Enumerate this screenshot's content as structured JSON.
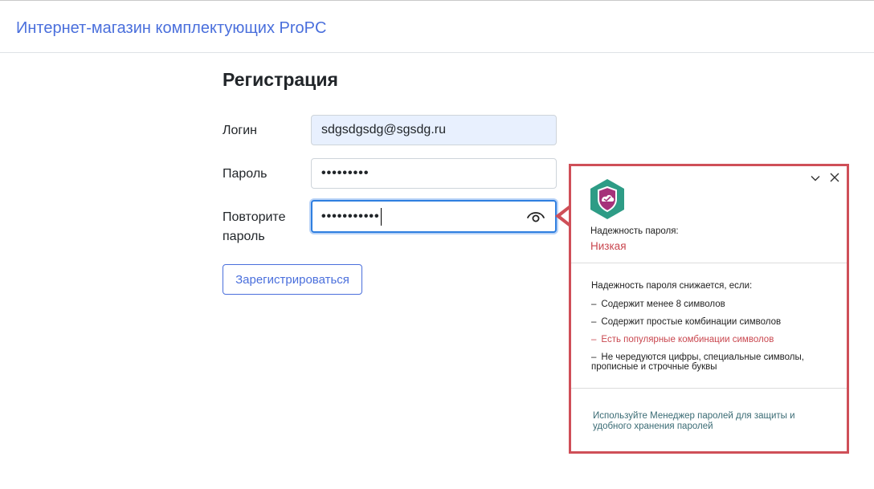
{
  "header": {
    "brand": "Интернет-магазин комплектующих ProPC"
  },
  "form": {
    "title": "Регистрация",
    "login_label": "Логин",
    "login_value": "sdgsdgsdg@sgsdg.ru",
    "password_label": "Пароль",
    "password_mask": "•••••••••",
    "repeat_label": "Повторите пароль",
    "repeat_mask": "•••••••••••",
    "submit_label": "Зарегистрироваться"
  },
  "popup": {
    "strength_label": "Надежность пароля:",
    "strength_value": "Низкая",
    "intro": "Надежность пароля снижается, если:",
    "items": [
      {
        "text": "Содержит менее 8 символов",
        "warning": false
      },
      {
        "text": "Содержит простые комбинации символов",
        "warning": false
      },
      {
        "text": "Есть популярные комбинации символов",
        "warning": true
      },
      {
        "text": "Не чередуются цифры, специальные символы, прописные и строчные буквы",
        "warning": false
      }
    ],
    "footer": "Используйте Менеджер паролей для защиты и удобного хранения паролей"
  },
  "icons": {
    "shield": "shield-icon",
    "eye": "eye-icon",
    "close": "close-icon",
    "collapse": "chevron-down-icon"
  },
  "colors": {
    "accent": "#4a6fdc",
    "focus": "#2f7fe0",
    "popup_border": "#cf4f58",
    "warning": "#c9474f",
    "shield": "#2e9c86"
  }
}
